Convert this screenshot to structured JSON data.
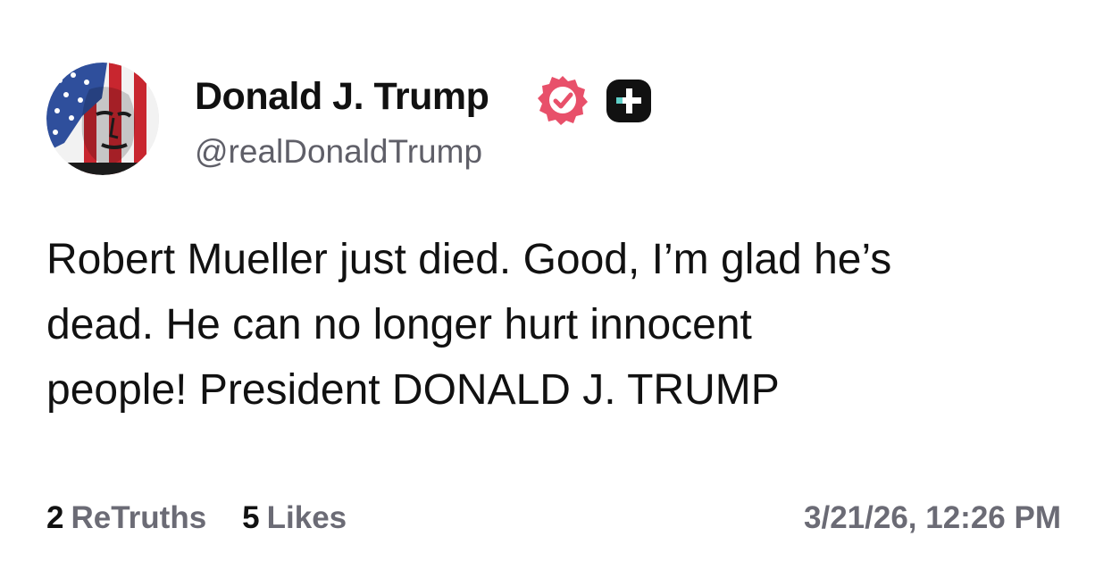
{
  "author": {
    "name": "Donald J. Trump",
    "handle": "@realDonaldTrump",
    "avatar_icon": "flag-portrait-avatar",
    "verified_icon": "verified-badge-icon",
    "verified_color": "#e8506a",
    "plus_badge_icon": "plus-badge-icon"
  },
  "post": {
    "lines": [
      "Robert Mueller just died. Good, I’m glad he’s",
      "dead. He can no longer hurt innocent",
      "people! President DONALD J. TRUMP"
    ]
  },
  "stats": {
    "retruths_count": "2",
    "retruths_label": "ReTruths",
    "likes_count": "5",
    "likes_label": "Likes"
  },
  "timestamp": "3/21/26, 12:26 PM"
}
